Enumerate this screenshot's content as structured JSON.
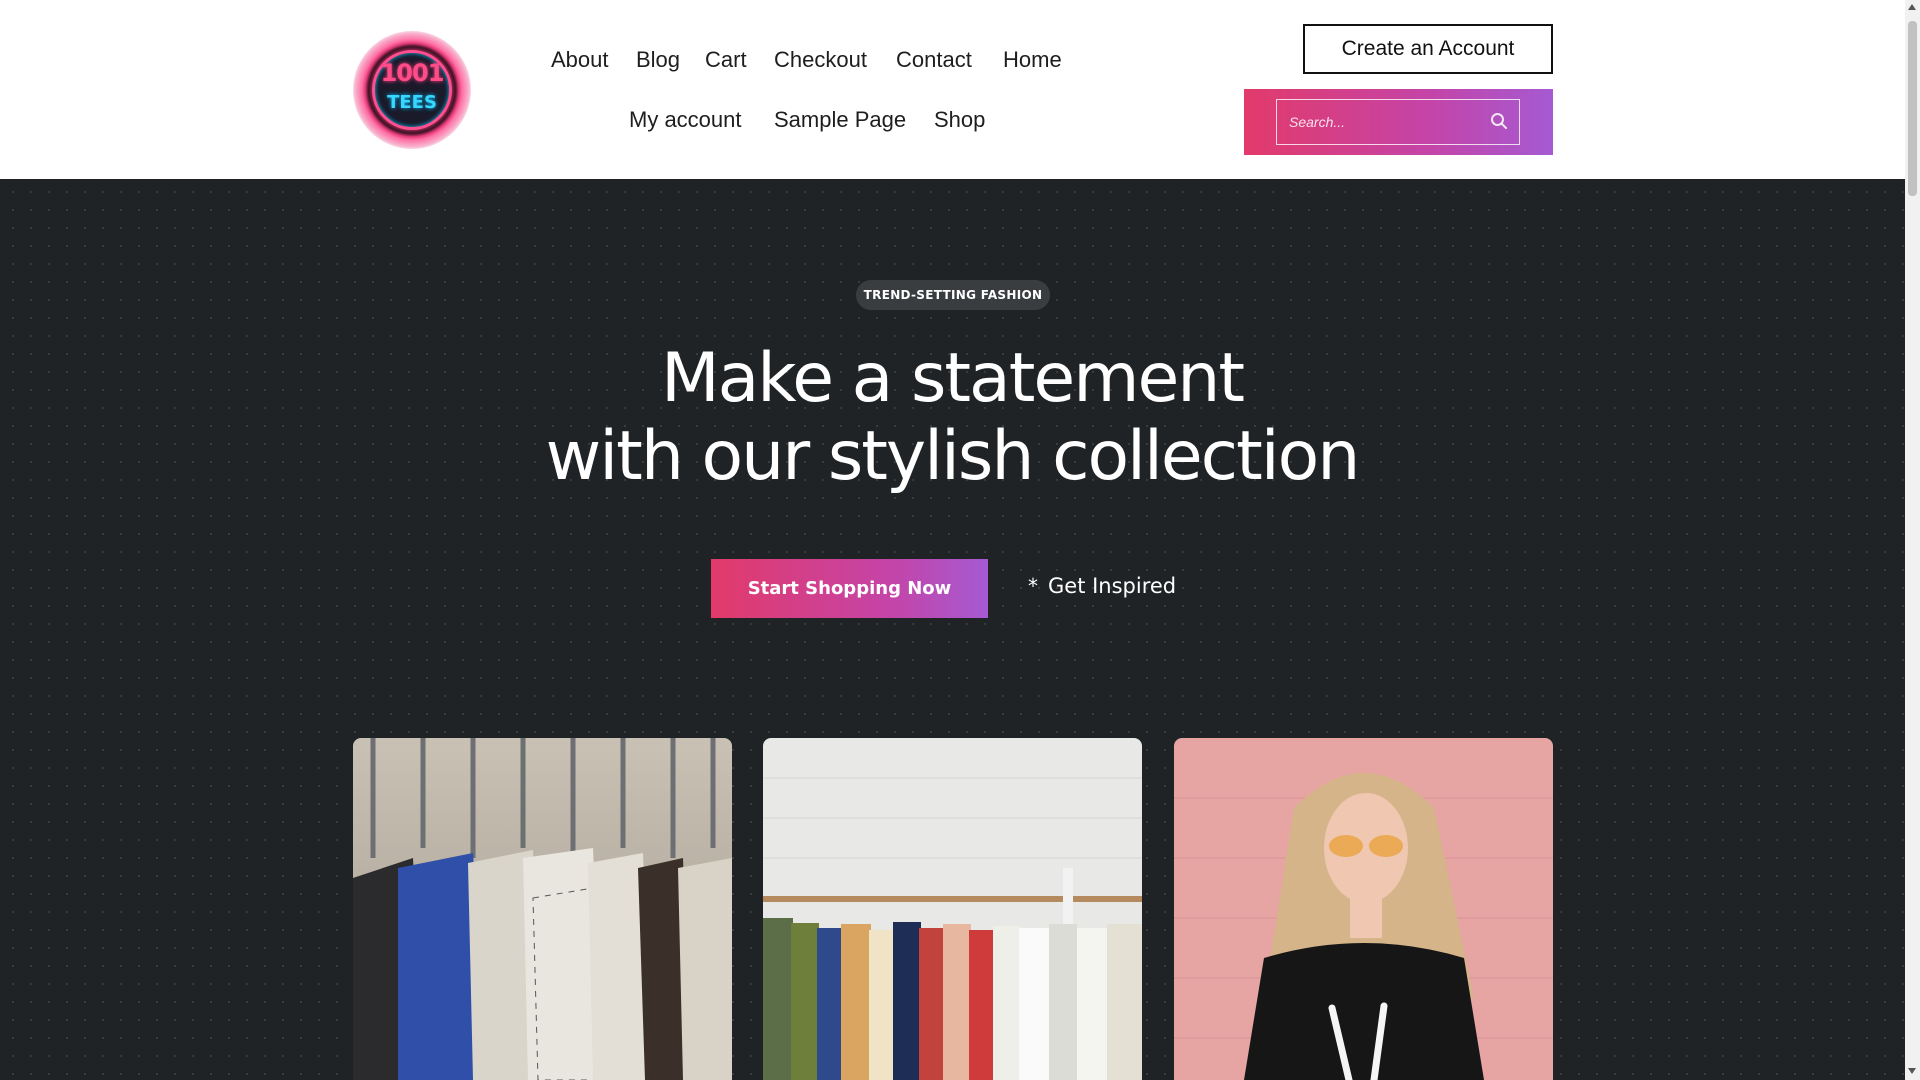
{
  "logo": {
    "line1": "1001",
    "line2": "TEES"
  },
  "nav": {
    "row1": [
      "About",
      "Blog",
      "Cart",
      "Checkout",
      "Contact",
      "Home"
    ],
    "row2": [
      "My account",
      "Sample Page",
      "Shop"
    ]
  },
  "header": {
    "account_button": "Create an Account",
    "search_placeholder": "Search..."
  },
  "hero": {
    "badge": "TREND-SETTING FASHION",
    "headline_line1": "Make a statement",
    "headline_line2": "with our stylish collection",
    "cta_label": "Start Shopping Now",
    "secondary_label": "Get Inspired",
    "secondary_icon": "*"
  },
  "colors": {
    "accent_start": "#e23a6a",
    "accent_end": "#a55ad2",
    "hero_bg": "#1f2326"
  }
}
